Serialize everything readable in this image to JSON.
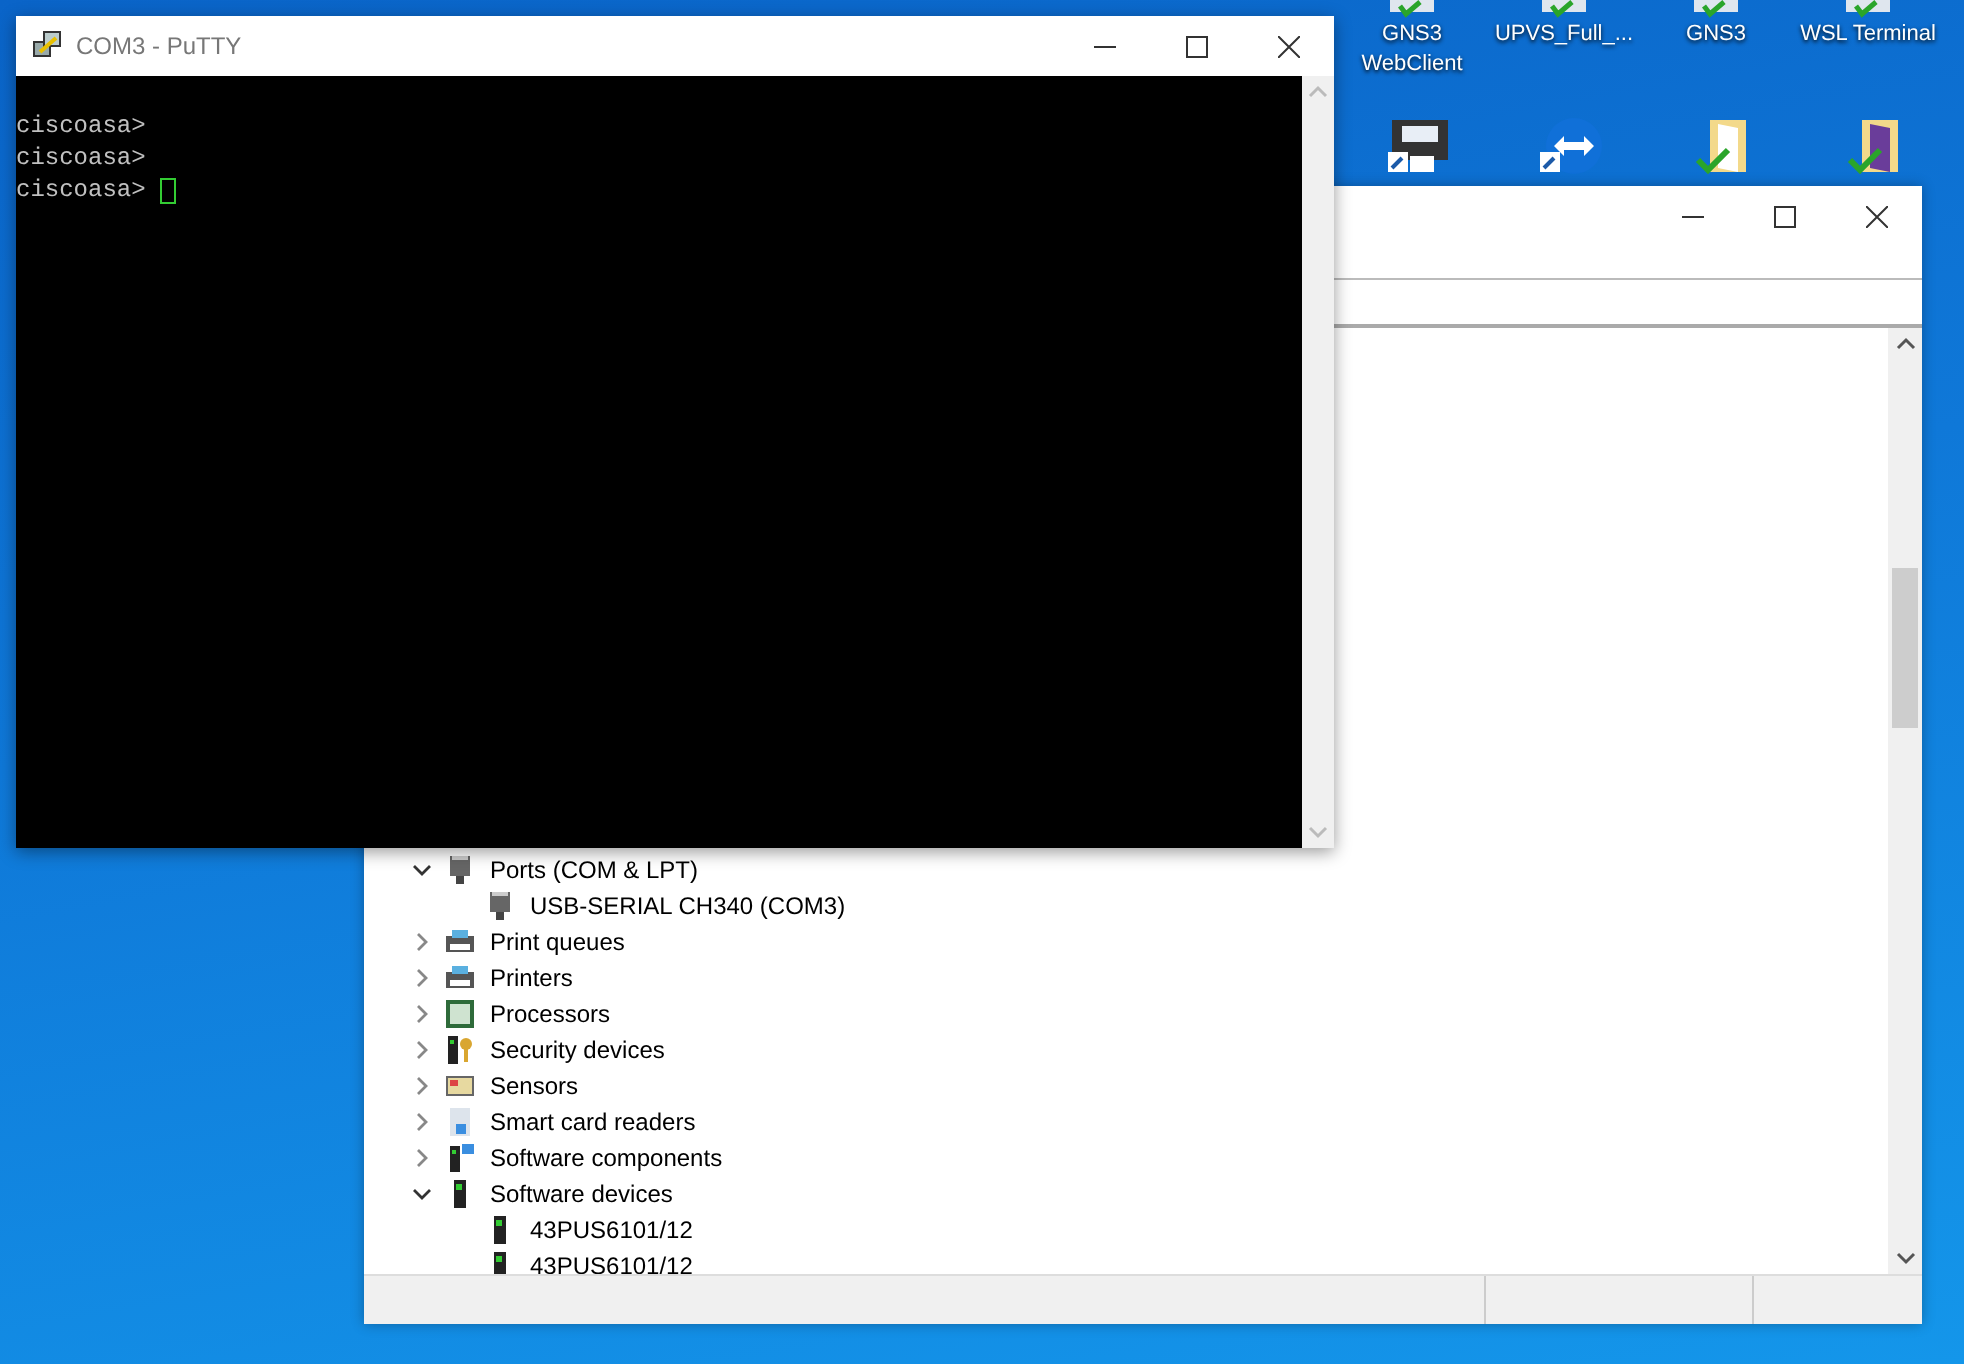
{
  "desktop": {
    "icons": [
      {
        "label": "GNS3 WebClient"
      },
      {
        "label": "UPVS_Full_..."
      },
      {
        "label": "GNS3"
      },
      {
        "label": "WSL Terminal"
      }
    ]
  },
  "device_manager": {
    "tree": [
      {
        "label": "Ports (COM & LPT)",
        "kind": "port",
        "expanded": true,
        "children": [
          {
            "label": "USB-SERIAL CH340 (COM3)",
            "kind": "port"
          }
        ]
      },
      {
        "label": "Print queues",
        "kind": "printer",
        "expanded": false
      },
      {
        "label": "Printers",
        "kind": "printer",
        "expanded": false
      },
      {
        "label": "Processors",
        "kind": "processor",
        "expanded": false
      },
      {
        "label": "Security devices",
        "kind": "security",
        "expanded": false
      },
      {
        "label": "Sensors",
        "kind": "sensor",
        "expanded": false
      },
      {
        "label": "Smart card readers",
        "kind": "smartcard",
        "expanded": false
      },
      {
        "label": "Software components",
        "kind": "component",
        "expanded": false
      },
      {
        "label": "Software devices",
        "kind": "software",
        "expanded": true,
        "children": [
          {
            "label": "43PUS6101/12",
            "kind": "software"
          },
          {
            "label": "43PUS6101/12",
            "kind": "software"
          }
        ]
      }
    ]
  },
  "putty": {
    "title": "COM3 - PuTTY",
    "lines": [
      "ciscoasa>",
      "ciscoasa>",
      "ciscoasa> "
    ],
    "cursor_visible": true
  }
}
